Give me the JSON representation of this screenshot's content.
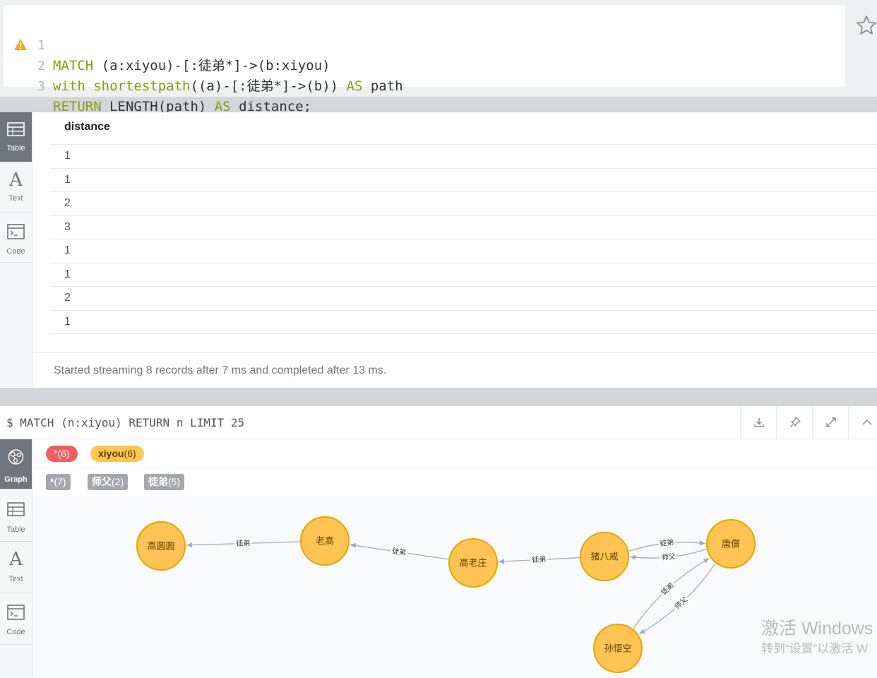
{
  "editor": {
    "lines": [
      {
        "num": "1",
        "parts": [
          [
            "kw",
            "MATCH"
          ],
          [
            "t",
            " (a:xiyou)-[:徒弟*]->(b:xiyou)"
          ]
        ]
      },
      {
        "num": "2",
        "parts": [
          [
            "kw",
            "with"
          ],
          [
            "t",
            " "
          ],
          [
            "fn",
            "shortestpath"
          ],
          [
            "t",
            "((a)-[:徒弟*]->(b)) "
          ],
          [
            "kw",
            "AS"
          ],
          [
            "t",
            " path"
          ]
        ]
      },
      {
        "num": "3",
        "parts": [
          [
            "kw",
            "RETURN"
          ],
          [
            "t",
            " LENGTH(path) "
          ],
          [
            "kw",
            "AS"
          ],
          [
            "t",
            " distance;"
          ]
        ]
      }
    ],
    "warning_icon": "warning-triangle-icon",
    "favorite_icon": "star-icon",
    "colors": {
      "keyword": "#8a9b0f",
      "warning": "#f5a623"
    }
  },
  "result_frame": {
    "sidebar": [
      {
        "label": "Table",
        "icon": "table-icon",
        "active": true
      },
      {
        "label": "Text",
        "icon": "text-icon",
        "active": false
      },
      {
        "label": "Code",
        "icon": "code-icon",
        "active": false
      }
    ],
    "column_header": "distance",
    "rows": [
      "1",
      "1",
      "2",
      "3",
      "1",
      "1",
      "2",
      "1"
    ],
    "status": "Started streaming 8 records after 7 ms and completed after 13 ms."
  },
  "graph_frame": {
    "query": "$ MATCH (n:xiyou) RETURN n LIMIT 25",
    "header_buttons": [
      {
        "name": "download-icon"
      },
      {
        "name": "pin-icon"
      },
      {
        "name": "expand-icon"
      },
      {
        "name": "collapse-up-icon"
      }
    ],
    "sidebar": [
      {
        "label": "Graph",
        "icon": "graph-icon",
        "active": true
      },
      {
        "label": "Table",
        "icon": "table-icon",
        "active": false
      },
      {
        "label": "Text",
        "icon": "text-icon",
        "active": false
      },
      {
        "label": "Code",
        "icon": "code-icon",
        "active": false
      }
    ],
    "node_labels": [
      {
        "text": "*",
        "count": "(6)",
        "color": "#f05d60"
      },
      {
        "text": "xiyou",
        "count": "(6)",
        "color": "#ffc454"
      }
    ],
    "rel_types": [
      {
        "text": "*",
        "count": "(7)"
      },
      {
        "text": "师父",
        "count": "(2)"
      },
      {
        "text": "徒弟",
        "count": "(5)"
      }
    ],
    "nodes": [
      {
        "id": "gyy",
        "name": "高圆圆"
      },
      {
        "id": "lg",
        "name": "老高"
      },
      {
        "id": "glz",
        "name": "高老庄"
      },
      {
        "id": "zbj",
        "name": "猪八戒"
      },
      {
        "id": "ts",
        "name": "唐僧"
      },
      {
        "id": "swk",
        "name": "孙悟空"
      }
    ],
    "edges": [
      {
        "from": "lg",
        "to": "gyy",
        "label": "徒弟"
      },
      {
        "from": "glz",
        "to": "lg",
        "label": "徒弟"
      },
      {
        "from": "zbj",
        "to": "glz",
        "label": "徒弟"
      },
      {
        "from": "zbj",
        "to": "ts",
        "label": "徒弟"
      },
      {
        "from": "ts",
        "to": "zbj",
        "label": "师父"
      },
      {
        "from": "swk",
        "to": "ts",
        "label": "徒弟"
      },
      {
        "from": "ts",
        "to": "swk",
        "label": "师父"
      }
    ],
    "node_color": "#ffc454",
    "node_border": "#e6a400"
  },
  "watermark": {
    "line1": "激活 Windows",
    "line2": "转到“设置”以激活 W"
  }
}
